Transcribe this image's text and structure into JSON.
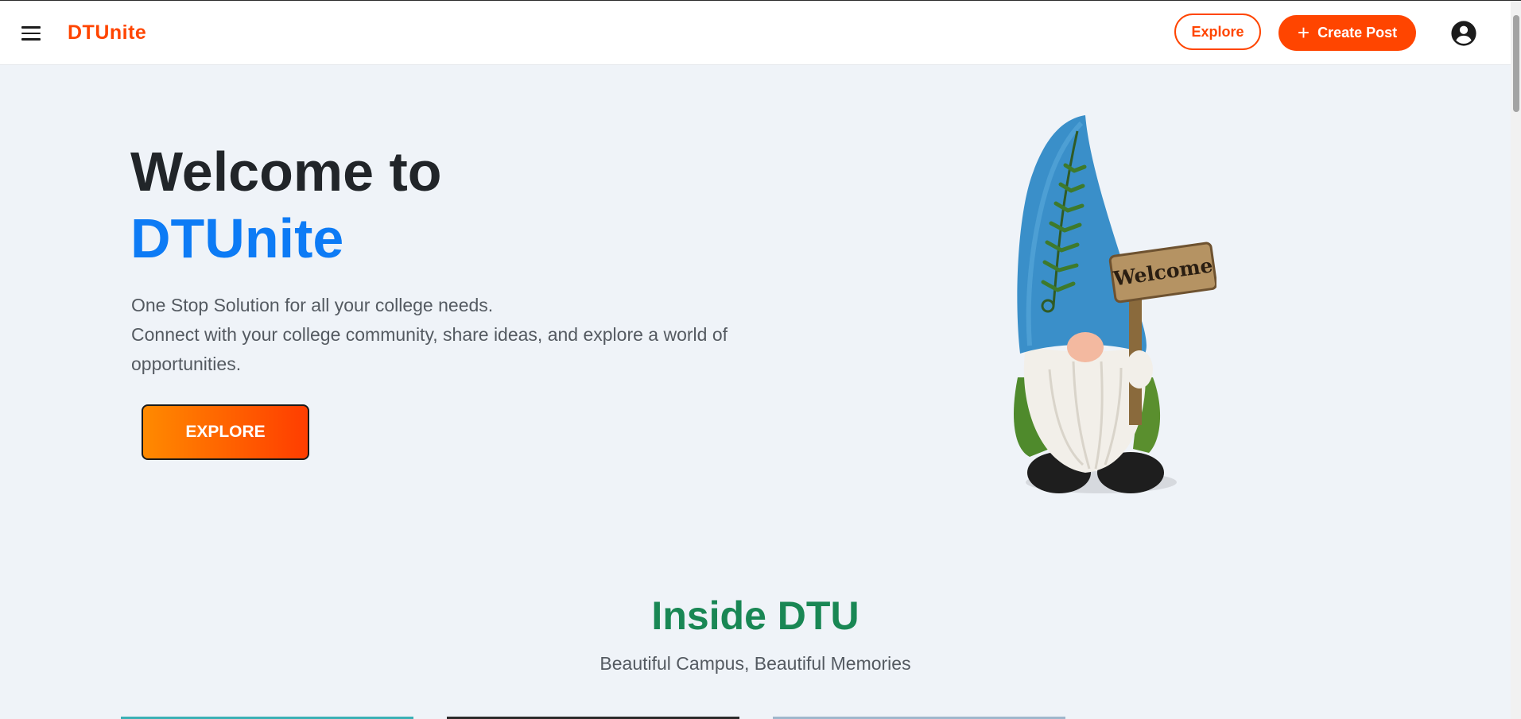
{
  "navbar": {
    "brand": "DTUnite",
    "explore_label": "Explore",
    "create_post_label": "Create Post",
    "create_post_icon": "+",
    "menu_icon": "hamburger-menu-icon",
    "account_icon": "account-circle-icon"
  },
  "hero": {
    "title_line1": "Welcome to",
    "title_line2": "DTUnite",
    "description_line1": "One Stop Solution for all your college needs.",
    "description_line2": "Connect with your college community, share ideas, and explore a world of opportunities.",
    "cta_label": "EXPLORE",
    "image_sign_text": "Welcome"
  },
  "section": {
    "title": "Inside DTU",
    "subtitle": "Beautiful Campus, Beautiful Memories"
  },
  "colors": {
    "brand": "#ff4500",
    "accent_blue": "#0d7bf5",
    "section_green": "#198754",
    "background": "#eff3f8"
  }
}
